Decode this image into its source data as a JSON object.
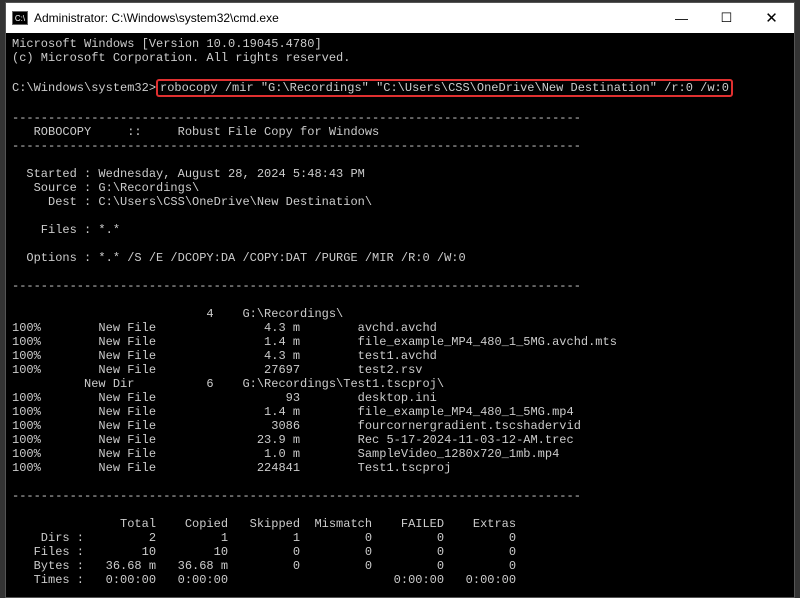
{
  "titlebar": {
    "icon_label": "C:\\",
    "title": "Administrator: C:\\Windows\\system32\\cmd.exe",
    "minimize": "—",
    "maximize": "☐",
    "close": "✕"
  },
  "terminal": {
    "version": "Microsoft Windows [Version 10.0.19045.4780]",
    "copyright": "(c) Microsoft Corporation. All rights reserved.",
    "prompt": "C:\\Windows\\system32>",
    "command": "robocopy /mir \"G:\\Recordings\" \"C:\\Users\\CSS\\OneDrive\\New Destination\" /r:0 /w:0",
    "dash_line": "-------------------------------------------------------------------------------",
    "header": "   ROBOCOPY     ::     Robust File Copy for Windows",
    "started": "  Started : Wednesday, August 28, 2024 5:48:43 PM",
    "source": "   Source : G:\\Recordings\\",
    "dest": "     Dest : C:\\Users\\CSS\\OneDrive\\New Destination\\",
    "files": "    Files : *.*",
    "options": "  Options : *.* /S /E /DCOPY:DA /COPY:DAT /PURGE /MIR /R:0 /W:0",
    "dir1": "                           4    G:\\Recordings\\",
    "row1": "100%        New File               4.3 m        avchd.avchd",
    "row2": "100%        New File               1.4 m        file_example_MP4_480_1_5MG.avchd.mts",
    "row3": "100%        New File               4.3 m        test1.avchd",
    "row4": "100%        New File               27697        test2.rsv",
    "dir2": "          New Dir          6    G:\\Recordings\\Test1.tscproj\\",
    "row5": "100%        New File                  93        desktop.ini",
    "row6": "100%        New File               1.4 m        file_example_MP4_480_1_5MG.mp4",
    "row7": "100%        New File                3086        fourcornergradient.tscshadervid",
    "row8": "100%        New File              23.9 m        Rec 5-17-2024-11-03-12-AM.trec",
    "row9": "100%        New File               1.0 m        SampleVideo_1280x720_1mb.mp4",
    "row10": "100%        New File              224841        Test1.tscproj",
    "summary_head": "               Total    Copied   Skipped  Mismatch    FAILED    Extras",
    "summary_dirs": "    Dirs :         2         1         1         0         0         0",
    "summary_files": "   Files :        10        10         0         0         0         0",
    "summary_bytes": "   Bytes :   36.68 m   36.68 m         0         0         0         0",
    "summary_times": "   Times :   0:00:00   0:00:00                       0:00:00   0:00:00"
  }
}
